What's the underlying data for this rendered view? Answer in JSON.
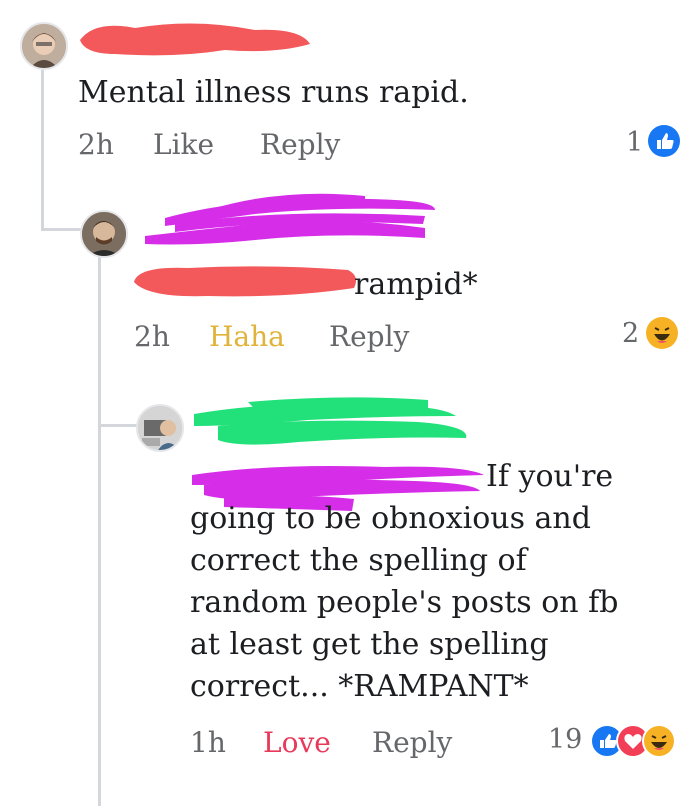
{
  "comments": [
    {
      "text": "Mental illness  runs rapid.",
      "time": "2h",
      "action": "Like",
      "reply": "Reply",
      "reaction_count": "1",
      "reactions": [
        "like-icon"
      ]
    },
    {
      "text": "rampid*",
      "time": "2h",
      "action": "Haha",
      "reply": "Reply",
      "reaction_count": "2",
      "reactions": [
        "haha-icon"
      ],
      "action_color": "#e0b33a"
    },
    {
      "text_first": "If you're",
      "text_lines": [
        "going to be obnoxious and",
        "correct the spelling of",
        "random people's posts on fb",
        "at least get the spelling",
        "correct...  *RAMPANT*"
      ],
      "time": "1h",
      "action": "Love",
      "reply": "Reply",
      "reaction_count": "19",
      "reactions": [
        "like-icon",
        "love-icon",
        "haha-icon"
      ],
      "action_color": "#e8395a"
    }
  ],
  "colors": {
    "like": "#1877f2",
    "love": "#f33e58",
    "haha": "#f7b125",
    "redaction_red": "#f3585a",
    "redaction_magenta": "#d62ee8",
    "redaction_green": "#22e07a"
  }
}
